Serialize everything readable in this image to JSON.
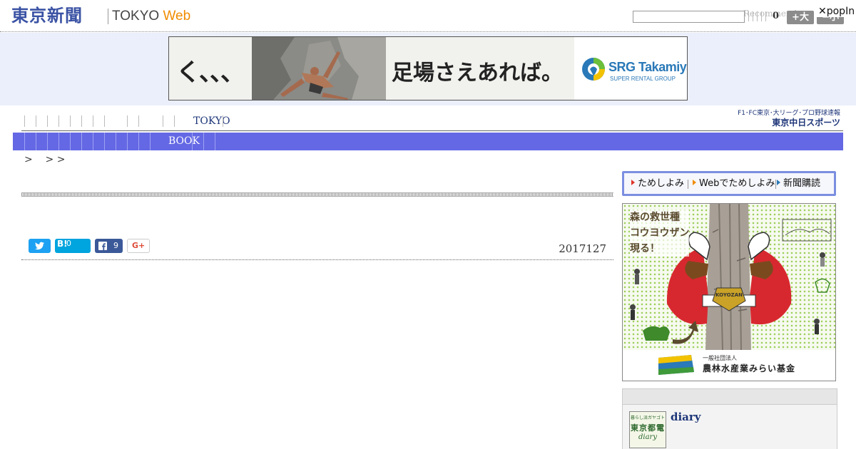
{
  "header": {
    "logo_jp": "東京新聞",
    "logo_en_tokyo": "TOKYO",
    "logo_en_web": "Web",
    "search_placeholder": "",
    "counter": "0",
    "recommend": "Recommend",
    "font_large": "+大",
    "font_small": "−小",
    "popin": "✕popIn"
  },
  "ad": {
    "kana": "く、、、",
    "copy": "足場さえあれば。",
    "brand": "SRG Takamiya",
    "brand_sub": "SUPER RENTAL GROUP"
  },
  "nav": {
    "primary_tokyo": "TOKYO",
    "secondary_book": "BOOK",
    "sports_line1": "F1･FC東京･大リーグ･プロ野球速報",
    "sports_line2": "東京中日スポーツ"
  },
  "breadcrumb": ">    > >",
  "share": {
    "hatena_label": "B!",
    "hatena_count": "0",
    "facebook_count": "9",
    "googleplus_label": "G+"
  },
  "article": {
    "date": "2017127"
  },
  "sidebar": {
    "trial_items": [
      "ためしよみ",
      "Webでためしよみ",
      "新聞購読"
    ],
    "fund_text": [
      "森の救世種",
      "コウヨウザン",
      "現る！"
    ],
    "fund_badge": "KOYOZAN",
    "fund_small": "一般社団法人",
    "fund_name": "農林水産業みらい基金",
    "diary_thumb_top": "暮らし派ガヤゴト",
    "diary_thumb_mid": "東京都電",
    "diary_thumb_bottom": "diary",
    "diary_title": "diary"
  },
  "colors": {
    "brand_blue": "#3a52a4",
    "nav_bar": "#6468e4",
    "web_orange": "#f08c00",
    "ad_band": "#eaeffb"
  }
}
